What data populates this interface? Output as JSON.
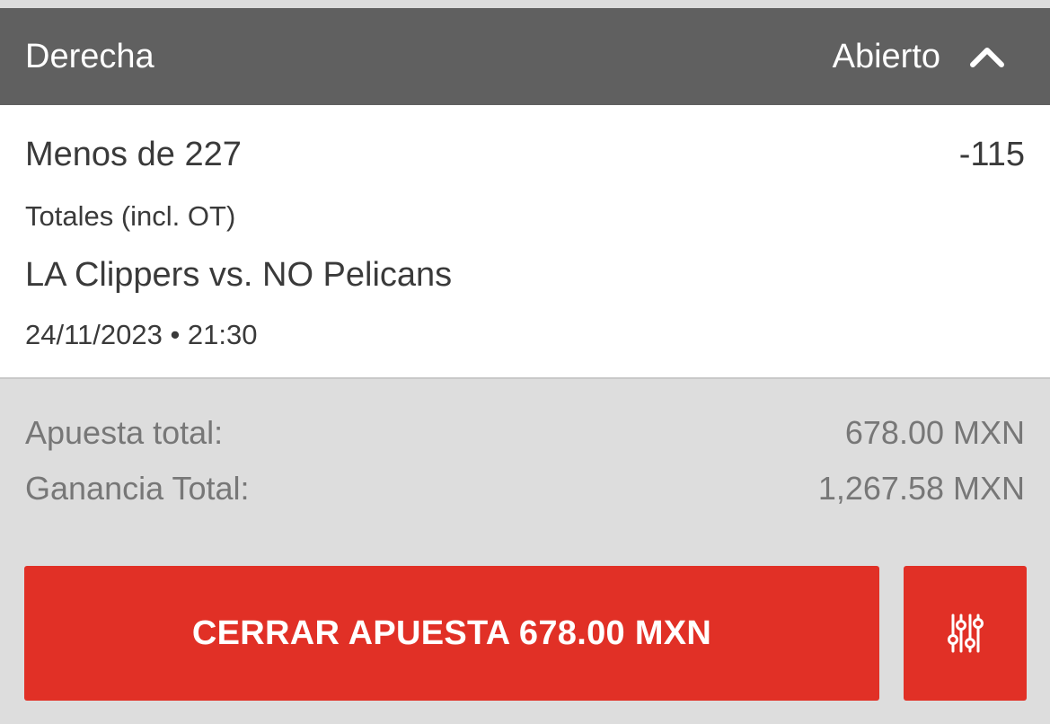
{
  "header": {
    "title": "Derecha",
    "status": "Abierto",
    "collapse_icon": "chevron-up-icon"
  },
  "selection": {
    "name": "Menos de 227",
    "odds": "-115",
    "market": "Totales (incl. OT)",
    "event": "LA Clippers vs. NO Pelicans",
    "datetime": "24/11/2023 • 21:30"
  },
  "summary": {
    "stake_label": "Apuesta total:",
    "stake_value": "678.00 MXN",
    "payout_label": "Ganancia Total:",
    "payout_value": "1,267.58 MXN"
  },
  "actions": {
    "cashout_label": "CERRAR APUESTA 678.00 MXN",
    "settings_icon": "sliders-icon"
  },
  "colors": {
    "header_bg": "#606060",
    "accent_red": "#e13026",
    "panel_bg": "#dddddd"
  }
}
